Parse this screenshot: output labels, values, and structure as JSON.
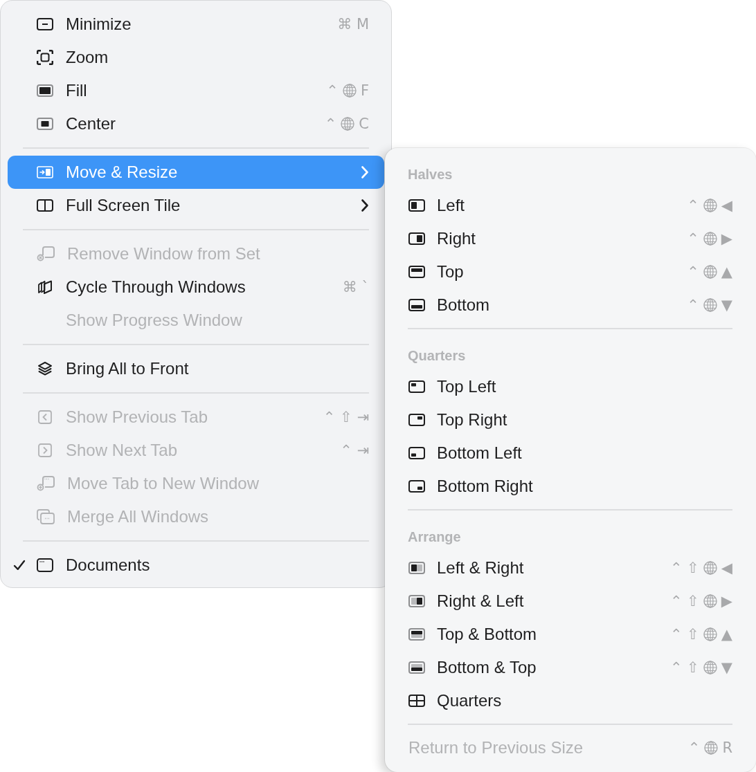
{
  "menu": {
    "items": [
      {
        "kind": "item",
        "label": "Minimize",
        "shortcut": [
          {
            "kind": "keys",
            "text": "⌘ M"
          }
        ],
        "selected": false,
        "disabled": false,
        "checked": false,
        "submenu": false
      },
      {
        "kind": "item",
        "label": "Zoom",
        "selected": false,
        "disabled": false,
        "checked": false,
        "submenu": false
      },
      {
        "kind": "item",
        "label": "Fill",
        "shortcut": [
          {
            "kind": "keys",
            "text": "⌃"
          },
          {
            "kind": "globe"
          },
          {
            "kind": "keys",
            "text": "F"
          }
        ],
        "selected": false,
        "disabled": false,
        "checked": false,
        "submenu": false
      },
      {
        "kind": "item",
        "label": "Center",
        "shortcut": [
          {
            "kind": "keys",
            "text": "⌃"
          },
          {
            "kind": "globe"
          },
          {
            "kind": "keys",
            "text": "C"
          }
        ],
        "selected": false,
        "disabled": false,
        "checked": false,
        "submenu": false
      },
      {
        "kind": "separator"
      },
      {
        "kind": "item",
        "label": "Move & Resize",
        "selected": true,
        "disabled": false,
        "checked": false,
        "submenu": true
      },
      {
        "kind": "item",
        "label": "Full Screen Tile",
        "selected": false,
        "disabled": false,
        "checked": false,
        "submenu": true
      },
      {
        "kind": "separator"
      },
      {
        "kind": "item",
        "label": "Remove Window from Set",
        "selected": false,
        "disabled": true,
        "checked": false,
        "submenu": false
      },
      {
        "kind": "item",
        "label": "Cycle Through Windows",
        "shortcut": [
          {
            "kind": "keys",
            "text": "⌘ `"
          }
        ],
        "selected": false,
        "disabled": false,
        "checked": false,
        "submenu": false
      },
      {
        "kind": "item",
        "label": "Show Progress Window",
        "selected": false,
        "disabled": true,
        "checked": false,
        "submenu": false
      },
      {
        "kind": "separator"
      },
      {
        "kind": "item",
        "label": "Bring All to Front",
        "selected": false,
        "disabled": false,
        "checked": false,
        "submenu": false
      },
      {
        "kind": "separator"
      },
      {
        "kind": "item",
        "label": "Show Previous Tab",
        "shortcut": [
          {
            "kind": "keys",
            "text": "⌃ ⇧ ⇥"
          }
        ],
        "selected": false,
        "disabled": true,
        "checked": false,
        "submenu": false
      },
      {
        "kind": "item",
        "label": "Show Next Tab",
        "shortcut": [
          {
            "kind": "keys",
            "text": "⌃ ⇥"
          }
        ],
        "selected": false,
        "disabled": true,
        "checked": false,
        "submenu": false
      },
      {
        "kind": "item",
        "label": "Move Tab to New Window",
        "selected": false,
        "disabled": true,
        "checked": false,
        "submenu": false
      },
      {
        "kind": "item",
        "label": "Merge All Windows",
        "selected": false,
        "disabled": true,
        "checked": false,
        "submenu": false
      },
      {
        "kind": "separator"
      },
      {
        "kind": "item",
        "label": "Documents",
        "selected": false,
        "disabled": false,
        "checked": true,
        "submenu": false
      }
    ]
  },
  "submenu": {
    "items": [
      {
        "kind": "header",
        "label": "Halves"
      },
      {
        "kind": "item",
        "label": "Left",
        "shortcut": [
          {
            "kind": "keys",
            "text": "⌃"
          },
          {
            "kind": "globe"
          },
          {
            "kind": "keys",
            "text": "◀"
          }
        ],
        "selected": false,
        "disabled": false
      },
      {
        "kind": "item",
        "label": "Right",
        "shortcut": [
          {
            "kind": "keys",
            "text": "⌃"
          },
          {
            "kind": "globe"
          },
          {
            "kind": "keys",
            "text": "▶"
          }
        ],
        "selected": false,
        "disabled": false
      },
      {
        "kind": "item",
        "label": "Top",
        "shortcut": [
          {
            "kind": "keys",
            "text": "⌃"
          },
          {
            "kind": "globe"
          },
          {
            "kind": "keys",
            "text": "▲"
          }
        ],
        "selected": false,
        "disabled": false
      },
      {
        "kind": "item",
        "label": "Bottom",
        "shortcut": [
          {
            "kind": "keys",
            "text": "⌃"
          },
          {
            "kind": "globe"
          },
          {
            "kind": "keys",
            "text": "▼"
          }
        ],
        "selected": false,
        "disabled": false
      },
      {
        "kind": "separator"
      },
      {
        "kind": "header",
        "label": "Quarters"
      },
      {
        "kind": "item",
        "label": "Top Left",
        "selected": false,
        "disabled": false
      },
      {
        "kind": "item",
        "label": "Top Right",
        "selected": false,
        "disabled": false
      },
      {
        "kind": "item",
        "label": "Bottom Left",
        "selected": false,
        "disabled": false
      },
      {
        "kind": "item",
        "label": "Bottom Right",
        "selected": false,
        "disabled": false
      },
      {
        "kind": "separator"
      },
      {
        "kind": "header",
        "label": "Arrange"
      },
      {
        "kind": "item",
        "label": "Left & Right",
        "shortcut": [
          {
            "kind": "keys",
            "text": "⌃ ⇧"
          },
          {
            "kind": "globe"
          },
          {
            "kind": "keys",
            "text": "◀"
          }
        ],
        "selected": false,
        "disabled": false
      },
      {
        "kind": "item",
        "label": "Right & Left",
        "shortcut": [
          {
            "kind": "keys",
            "text": "⌃ ⇧"
          },
          {
            "kind": "globe"
          },
          {
            "kind": "keys",
            "text": "▶"
          }
        ],
        "selected": false,
        "disabled": false
      },
      {
        "kind": "item",
        "label": "Top & Bottom",
        "shortcut": [
          {
            "kind": "keys",
            "text": "⌃ ⇧"
          },
          {
            "kind": "globe"
          },
          {
            "kind": "keys",
            "text": "▲"
          }
        ],
        "selected": false,
        "disabled": false
      },
      {
        "kind": "item",
        "label": "Bottom & Top",
        "shortcut": [
          {
            "kind": "keys",
            "text": "⌃ ⇧"
          },
          {
            "kind": "globe"
          },
          {
            "kind": "keys",
            "text": "▼"
          }
        ],
        "selected": false,
        "disabled": false
      },
      {
        "kind": "item",
        "label": "Quarters",
        "selected": false,
        "disabled": false
      },
      {
        "kind": "separator"
      },
      {
        "kind": "item",
        "label": "Return to Previous Size",
        "shortcut": [
          {
            "kind": "keys",
            "text": "⌃"
          },
          {
            "kind": "globe"
          },
          {
            "kind": "keys",
            "text": "R"
          }
        ],
        "selected": false,
        "disabled": true
      }
    ]
  }
}
